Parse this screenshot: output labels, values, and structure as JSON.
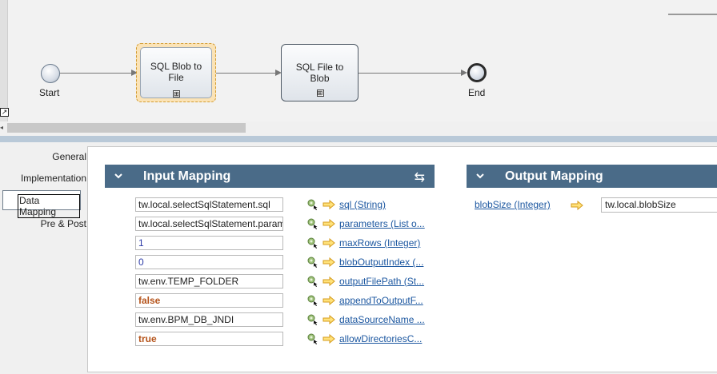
{
  "process": {
    "start_label": "Start",
    "end_label": "End",
    "tasks": [
      {
        "label_line1": "SQL Blob to",
        "label_line2": "File",
        "expand_glyph": "⊞"
      },
      {
        "label_line1": "SQL File to",
        "label_line2": "Blob",
        "expand_glyph": "⊞"
      }
    ]
  },
  "sidebar": {
    "items": [
      {
        "label": "General"
      },
      {
        "label": "Implementation"
      },
      {
        "label": "Data Mapping"
      },
      {
        "label": "Pre & Post"
      }
    ],
    "active": "Data Mapping"
  },
  "input_mapping": {
    "title": "Input Mapping",
    "rows": [
      {
        "value": "tw.local.selectSqlStatement.sql",
        "param": "sql (String)",
        "kind": "text"
      },
      {
        "value": "tw.local.selectSqlStatement.param",
        "param": "parameters (List o...",
        "kind": "text"
      },
      {
        "value": "1",
        "param": "maxRows (Integer)",
        "kind": "num"
      },
      {
        "value": "0",
        "param": "blobOutputIndex (...",
        "kind": "num"
      },
      {
        "value": "tw.env.TEMP_FOLDER",
        "param": "outputFilePath (St...",
        "kind": "text"
      },
      {
        "value": "false",
        "param": "appendToOutputF...",
        "kind": "bool"
      },
      {
        "value": "tw.env.BPM_DB_JNDI",
        "param": "dataSourceName ...",
        "kind": "text"
      },
      {
        "value": "true",
        "param": "allowDirectoriesC...",
        "kind": "bool"
      }
    ]
  },
  "output_mapping": {
    "title": "Output Mapping",
    "rows": [
      {
        "param": "blobSize (Integer)",
        "value": "tw.local.blobSize"
      }
    ]
  },
  "icons": {
    "collapse": "chevron-down-icon",
    "swap": "swap-arrows-icon",
    "variable_picker": "variable-picker-icon",
    "map_arrow": "right-arrow-icon"
  },
  "colors": {
    "section_header": "#4a6b88",
    "link": "#1c57a0",
    "selected_task": "#fbe3b6",
    "bool_value": "#b5541b",
    "num_value": "#2b3aa6"
  }
}
